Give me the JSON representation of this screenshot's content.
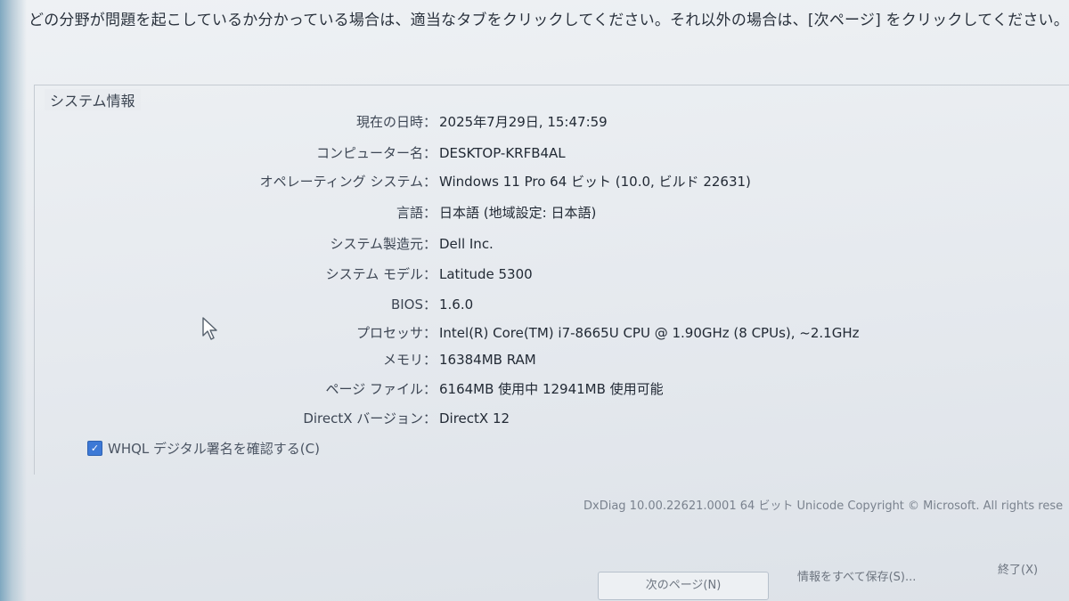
{
  "instruction": "どの分野が問題を起こしているか分かっている場合は、適当なタブをクリックしてください。それ以外の場合は、[次ページ] をクリックしてください。",
  "system_info": {
    "title": "システム情報",
    "rows": [
      {
        "label": "現在の日時：",
        "value": "2025年7月29日, 15:47:59"
      },
      {
        "label": "コンピューター名：",
        "value": "DESKTOP-KRFB4AL"
      },
      {
        "label": "オペレーティング システム：",
        "value": "Windows 11 Pro 64 ビット (10.0, ビルド 22631)"
      },
      {
        "label": "言語：",
        "value": "日本語 (地域設定: 日本語)"
      },
      {
        "label": "システム製造元：",
        "value": "Dell Inc."
      },
      {
        "label": "システム モデル：",
        "value": "Latitude 5300"
      },
      {
        "label": "BIOS：",
        "value": "1.6.0"
      },
      {
        "label": "プロセッサ：",
        "value": "Intel(R) Core(TM) i7-8665U CPU @ 1.90GHz (8 CPUs), ~2.1GHz"
      },
      {
        "label": "メモリ：",
        "value": "16384MB RAM"
      },
      {
        "label": "ページ ファイル：",
        "value": "6164MB 使用中 12941MB 使用可能"
      },
      {
        "label": "DirectX バージョン：",
        "value": "DirectX 12"
      }
    ]
  },
  "whql": {
    "label": "WHQL デジタル署名を確認する(C)",
    "checked": true
  },
  "footer": {
    "version": "DxDiag 10.00.22621.0001 64 ビット Unicode Copyright © Microsoft. All rights rese"
  },
  "buttons": {
    "next": "次のページ(N)",
    "save": "情報をすべて保存(S)...",
    "exit": "終了(X)"
  },
  "colors": {
    "accent": "#3d79d6",
    "background": "#e9ecf0"
  }
}
